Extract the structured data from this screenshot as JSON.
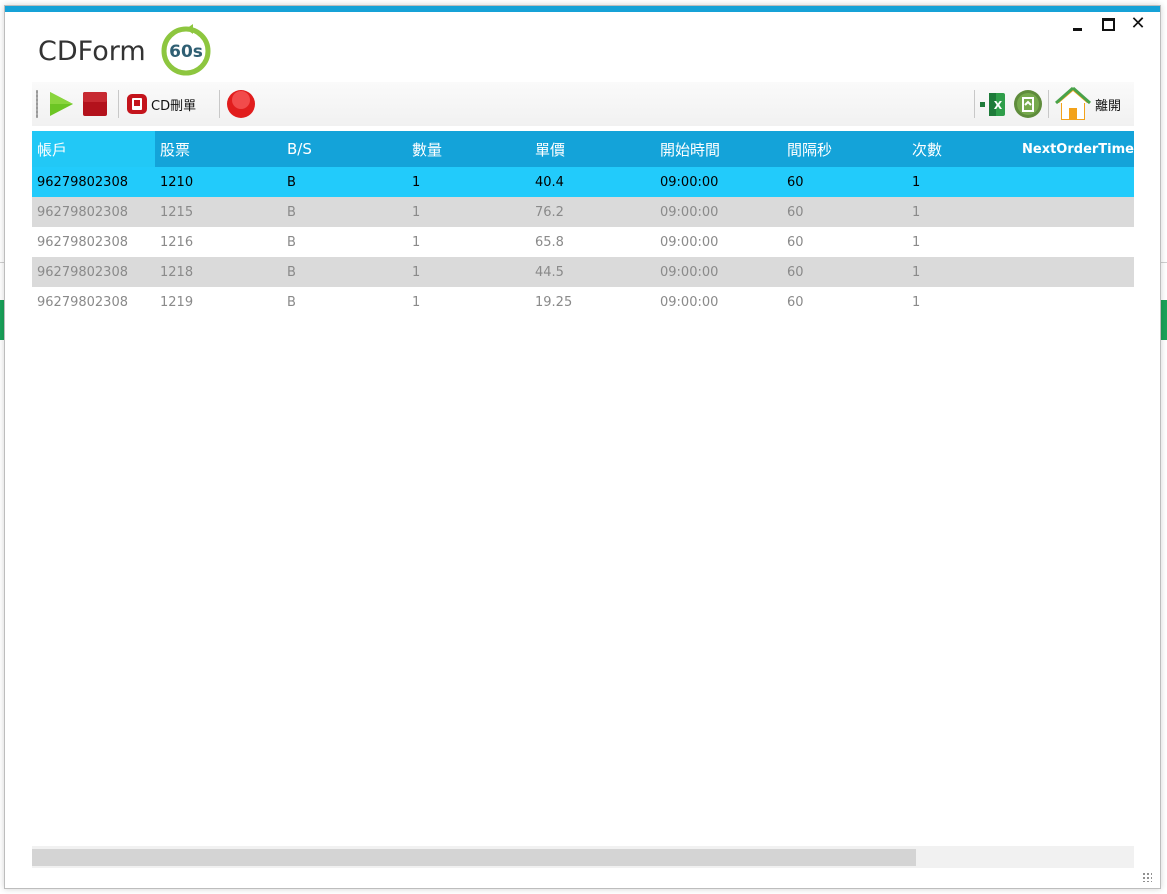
{
  "window": {
    "title": "CDForm",
    "timer_badge": "60s",
    "accent_color": "#16a2d7",
    "controls": [
      "minimize-icon",
      "maximize-icon",
      "close-icon"
    ],
    "close_glyph": "✕"
  },
  "toolbar": {
    "left_buttons": [
      "play-icon",
      "stop-icon",
      "delete-cd-icon",
      "record-icon"
    ],
    "delete_label": "CD刪單",
    "right_buttons": [
      "export-excel-icon",
      "refresh-icon",
      "home-icon"
    ],
    "exit_label": "離開"
  },
  "grid": {
    "columns": [
      "帳戶",
      "股票",
      "B/S",
      "數量",
      "單價",
      "開始時間",
      "間隔秒",
      "次數",
      "NextOrderTime"
    ],
    "rows": [
      [
        "96279802308",
        "1210",
        "B",
        "1",
        "40.4",
        "09:00:00",
        "60",
        "1",
        ""
      ],
      [
        "96279802308",
        "1215",
        "B",
        "1",
        "76.2",
        "09:00:00",
        "60",
        "1",
        ""
      ],
      [
        "96279802308",
        "1216",
        "B",
        "1",
        "65.8",
        "09:00:00",
        "60",
        "1",
        ""
      ],
      [
        "96279802308",
        "1218",
        "B",
        "1",
        "44.5",
        "09:00:00",
        "60",
        "1",
        ""
      ],
      [
        "96279802308",
        "1219",
        "B",
        "1",
        "19.25",
        "09:00:00",
        "60",
        "1",
        ""
      ]
    ],
    "selected_row_index": 0,
    "header_color": "#14a3d9",
    "selected_color": "#22cbfb",
    "alt_row_color": "#dadada"
  }
}
